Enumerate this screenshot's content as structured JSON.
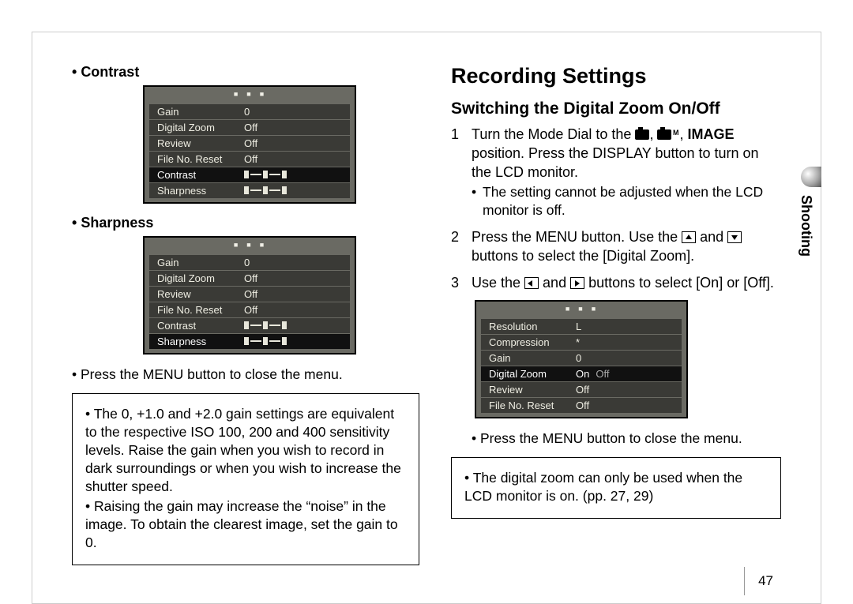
{
  "pageNumber": "47",
  "sideTab": "Shooting",
  "left": {
    "contrastLabel": "Contrast",
    "sharpnessLabel": "Sharpness",
    "closeMenuNote": "Press the MENU button to close the menu.",
    "lcdMenu": {
      "rows": [
        {
          "k": "Gain",
          "v": "0"
        },
        {
          "k": "Digital Zoom",
          "v": "Off"
        },
        {
          "k": "Review",
          "v": "Off"
        },
        {
          "k": "File No. Reset",
          "v": "Off"
        },
        {
          "k": "Contrast",
          "v": "slider"
        },
        {
          "k": "Sharpness",
          "v": "slider"
        }
      ]
    },
    "infoBox": {
      "b1": "The 0, +1.0 and +2.0 gain settings are equivalent to the respective ISO 100, 200 and 400 sensitivity levels. Raise the gain when you wish to record in dark surroundings or when you wish to increase the shutter speed.",
      "b2": "Raising the gain may increase the “noise” in the image. To obtain the clearest image, set the gain to 0."
    }
  },
  "right": {
    "heading": "Recording Settings",
    "subheading": "Switching the Digital Zoom On/Off",
    "step1_a": "Turn the Mode Dial to the ",
    "step1_b": ", ",
    "step1_c": ", ",
    "step1_bold": "IMAGE",
    "step1_d": " position. Press the DISPLAY button to turn on the LCD monitor.",
    "step1_sub": "The setting cannot be adjusted when the LCD monitor is off.",
    "step2_a": "Press the MENU button. Use the ",
    "step2_b": " and ",
    "step2_c": " buttons to select the [Digital Zoom].",
    "step3_a": "Use the ",
    "step3_b": " and ",
    "step3_c": " buttons to select [On] or [Off].",
    "lcdMenu": {
      "rows": [
        {
          "k": "Resolution",
          "v": "L"
        },
        {
          "k": "Compression",
          "v": "*"
        },
        {
          "k": "Gain",
          "v": "0"
        },
        {
          "k": "Digital Zoom",
          "v_on": "On",
          "v_off": "Off",
          "hl": true
        },
        {
          "k": "Review",
          "v": "Off"
        },
        {
          "k": "File No. Reset",
          "v": "Off"
        }
      ]
    },
    "closeMenuNote": "Press the MENU button to close the menu.",
    "infoBox": "The digital zoom can only be used when the LCD monitor is on. (pp. 27, 29)"
  }
}
